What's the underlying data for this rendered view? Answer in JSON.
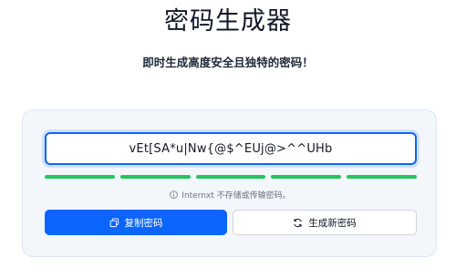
{
  "header": {
    "title": "密码生成器",
    "subtitle": "即时生成高度安全且独特的密码！"
  },
  "generator": {
    "password": "vEt[SA*u|Nw{@$^EUj@>^^UHb",
    "strength_segments": 5,
    "strength_color": "#22c55e",
    "note": "Internxt 不存储或传输密码。",
    "copy_label": "复制密码",
    "generate_label": "生成新密码"
  },
  "colors": {
    "accent": "#0a66ff",
    "strength": "#22c55e"
  },
  "icons": {
    "info": "info-icon",
    "copy": "copy-icon",
    "refresh": "refresh-icon"
  }
}
